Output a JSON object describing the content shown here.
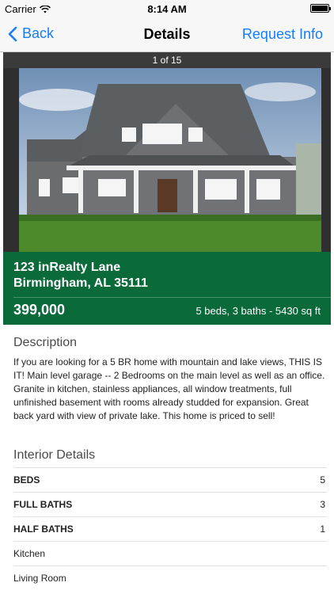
{
  "status_bar": {
    "carrier": "Carrier",
    "time": "8:14 AM"
  },
  "nav": {
    "back_label": "Back",
    "title": "Details",
    "right_label": "Request Info"
  },
  "photo": {
    "counter": "1 of 15"
  },
  "listing": {
    "address_line1": "123 inRealty Lane",
    "address_line2": "Birmingham, AL 35111",
    "price": "399,000",
    "summary": "5 beds, 3 baths - 5430 sq ft"
  },
  "description": {
    "header": "Description",
    "text": "If you are looking for a 5 BR home with mountain and lake views, THIS IS IT! Main level garage -- 2 Bedrooms on the main level as well as an office. Granite in kitchen, stainless appliances, all window treatments, full unfinished basement with rooms already studded for expansion. Great back yard with view of private lake. This home is priced to sell!"
  },
  "interior": {
    "header": "Interior Details",
    "rows": [
      {
        "label": "BEDS",
        "value": "5"
      },
      {
        "label": "FULL BATHS",
        "value": "3"
      },
      {
        "label": "HALF BATHS",
        "value": "1"
      },
      {
        "label": "Kitchen",
        "value": ""
      },
      {
        "label": "Living Room",
        "value": ""
      }
    ]
  },
  "colors": {
    "accent": "#157efb",
    "band": "#0b6a3a"
  }
}
